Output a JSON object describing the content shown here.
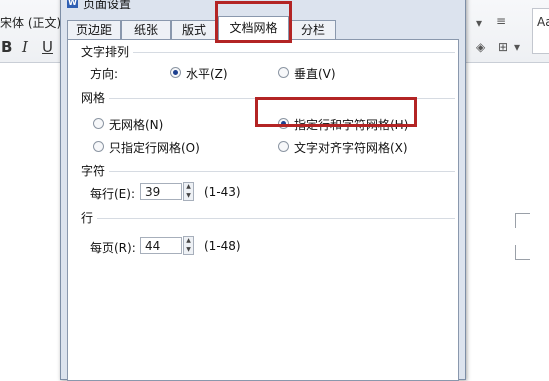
{
  "background": {
    "font_name": "宋体 (正文)",
    "bold": "B",
    "italic": "I",
    "underline": "U",
    "style_sample": "Aa"
  },
  "dialog": {
    "title": "页面设置",
    "tabs": [
      {
        "label": "页边距"
      },
      {
        "label": "纸张"
      },
      {
        "label": "版式"
      },
      {
        "label": "文档网格"
      },
      {
        "label": "分栏"
      }
    ],
    "text_direction": {
      "title": "文字排列",
      "direction_label": "方向:",
      "horizontal": "水平(Z)",
      "vertical": "垂直(V)",
      "selected": "水平(Z)"
    },
    "grid": {
      "title": "网格",
      "options": [
        "无网格(N)",
        "指定行和字符网格(H)",
        "只指定行网格(O)",
        "文字对齐字符网格(X)"
      ],
      "selected": "指定行和字符网格(H)"
    },
    "chars": {
      "title": "字符",
      "per_line_label": "每行(E):",
      "per_line_value": "39",
      "range": "(1-43)"
    },
    "lines": {
      "title": "行",
      "per_page_label": "每页(R):",
      "per_page_value": "44",
      "range": "(1-48)"
    }
  },
  "colors": {
    "highlight": "#b32424",
    "dialog_bg": "#dce3ee"
  }
}
